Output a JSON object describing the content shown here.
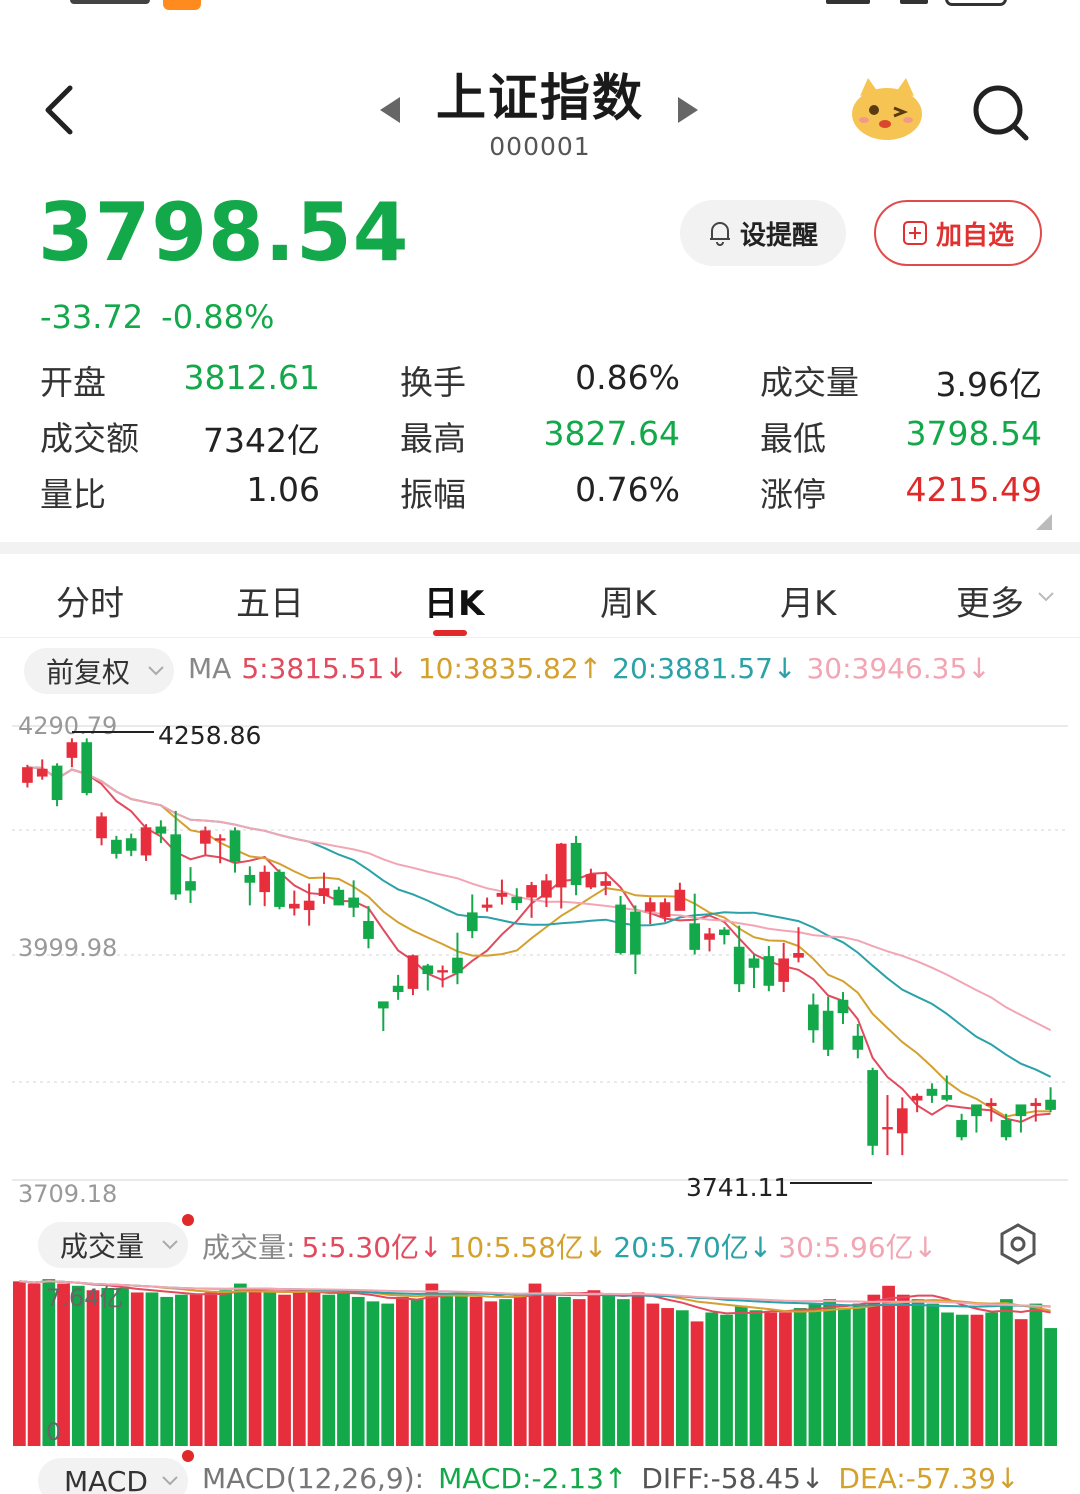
{
  "header": {
    "title": "上证指数",
    "code": "000001"
  },
  "quote": {
    "price": "3798.54",
    "change": "-33.72",
    "change_pct": "-0.88%"
  },
  "actions": {
    "alert_label": "设提醒",
    "watch_label": "加自选"
  },
  "stats": [
    [
      {
        "label": "开盘",
        "value": "3812.61",
        "tone": "green"
      },
      {
        "label": "换手",
        "value": "0.86%",
        "tone": "neutral"
      },
      {
        "label": "成交量",
        "value": "3.96亿",
        "tone": "neutral"
      }
    ],
    [
      {
        "label": "成交额",
        "value": "7342亿",
        "tone": "neutral"
      },
      {
        "label": "最高",
        "value": "3827.64",
        "tone": "green"
      },
      {
        "label": "最低",
        "value": "3798.54",
        "tone": "green"
      }
    ],
    [
      {
        "label": "量比",
        "value": "1.06",
        "tone": "neutral"
      },
      {
        "label": "振幅",
        "value": "0.76%",
        "tone": "neutral"
      },
      {
        "label": "涨停",
        "value": "4215.49",
        "tone": "red"
      }
    ]
  ],
  "tabs": [
    "分时",
    "五日",
    "日K",
    "周K",
    "月K",
    "更多"
  ],
  "active_tab": "日K",
  "kline": {
    "adjust_label": "前复权",
    "ma_prefix": "MA",
    "ma": [
      {
        "label": "5:3815.51",
        "color": "#e24a5e",
        "trend": "↓"
      },
      {
        "label": "10:3835.82",
        "color": "#d4a12f",
        "trend": "↑"
      },
      {
        "label": "20:3881.57",
        "color": "#2aa2a8",
        "trend": "↓"
      },
      {
        "label": "30:3946.35",
        "color": "#f2a6b4",
        "trend": "↓"
      }
    ],
    "axis_top": "4290.79",
    "axis_mid": "3999.98",
    "axis_bottom": "3709.18",
    "high_mark": "4258.86",
    "low_mark": "3741.11"
  },
  "volume": {
    "pill_label": "成交量",
    "prefix": "成交量:",
    "ma": [
      {
        "label": "5:5.30亿",
        "color": "#e24a5e",
        "trend": "↓"
      },
      {
        "label": "10:5.58亿",
        "color": "#d4a12f",
        "trend": "↓"
      },
      {
        "label": "20:5.70亿",
        "color": "#2aa2a8",
        "trend": "↓"
      },
      {
        "label": "30:5.96亿",
        "color": "#f2a6b4",
        "trend": "↓"
      }
    ],
    "axis_top": "7.64亿",
    "axis_bottom": "0"
  },
  "macd": {
    "pill_label": "MACD",
    "params": "MACD(12,26,9):",
    "macd": "MACD:-2.13↑",
    "diff": "DIFF:-58.45↓",
    "dea": "DEA:-57.39↓",
    "colors": {
      "macd": "#13a84a",
      "diff": "#555555",
      "dea": "#d4a12f"
    }
  },
  "colors": {
    "up": "#e62e3d",
    "down": "#13a84a",
    "accent": "#e02a2a"
  },
  "chart_data": [
    {
      "type": "candlestick",
      "title": "",
      "ylim": [
        3709.18,
        4290.79
      ],
      "y_ticks": [
        "4290.79",
        "3999.98",
        "3709.18"
      ],
      "annotations": [
        "4258.86",
        "3741.11"
      ],
      "candles": [
        [
          4218,
          4238,
          4212,
          4241
        ],
        [
          4226,
          4236,
          4222,
          4248
        ],
        [
          4240,
          4196,
          4188,
          4243
        ],
        [
          4250,
          4270,
          4238,
          4275
        ],
        [
          4270,
          4205,
          4202,
          4275
        ],
        [
          4147,
          4175,
          4138,
          4180
        ],
        [
          4145,
          4127,
          4121,
          4150
        ],
        [
          4147,
          4131,
          4124,
          4153
        ],
        [
          4125,
          4161,
          4118,
          4165
        ],
        [
          4162,
          4153,
          4141,
          4170
        ],
        [
          4152,
          4075,
          4068,
          4182
        ],
        [
          4092,
          4080,
          4064,
          4110
        ],
        [
          4140,
          4157,
          4126,
          4162
        ],
        [
          4144,
          4147,
          4115,
          4152
        ],
        [
          4157,
          4117,
          4103,
          4161
        ],
        [
          4100,
          4090,
          4061,
          4111
        ],
        [
          4078,
          4104,
          4060,
          4112
        ],
        [
          4104,
          4059,
          4056,
          4107
        ],
        [
          4057,
          4063,
          4048,
          4080
        ],
        [
          4055,
          4067,
          4035,
          4089
        ],
        [
          4073,
          4083,
          4063,
          4103
        ],
        [
          4081,
          4061,
          4061,
          4085
        ],
        [
          4071,
          4058,
          4046,
          4093
        ],
        [
          4041,
          4018,
          4006,
          4060
        ],
        [
          3938,
          3929,
          3900,
          3930
        ],
        [
          3958,
          3950,
          3940,
          3972
        ],
        [
          3954,
          3997,
          3946,
          3998
        ],
        [
          3984,
          3973,
          3952,
          3986
        ],
        [
          3975,
          3978,
          3956,
          3984
        ],
        [
          3994,
          3974,
          3960,
          4026
        ],
        [
          4052,
          4028,
          4019,
          4075
        ],
        [
          4058,
          4062,
          4053,
          4071
        ],
        [
          4072,
          4077,
          4062,
          4094
        ],
        [
          4072,
          4064,
          4055,
          4083
        ],
        [
          4071,
          4087,
          4045,
          4091
        ],
        [
          4071,
          4093,
          4059,
          4101
        ],
        [
          4084,
          4140,
          4057,
          4141
        ],
        [
          4141,
          4087,
          4074,
          4150
        ],
        [
          4084,
          4101,
          4082,
          4108
        ],
        [
          4086,
          4092,
          4074,
          4104
        ],
        [
          4062,
          4000,
          3998,
          4073
        ],
        [
          4053,
          3998,
          3973,
          4061
        ],
        [
          4053,
          4065,
          4037,
          4071
        ],
        [
          4046,
          4065,
          4040,
          4070
        ],
        [
          4054,
          4081,
          4069,
          4090
        ],
        [
          4038,
          4004,
          3998,
          4076
        ],
        [
          4017,
          4025,
          4002,
          4032
        ],
        [
          4030,
          4023,
          4011,
          4033
        ],
        [
          4008,
          3960,
          3950,
          4035
        ],
        [
          3993,
          3981,
          3955,
          3998
        ],
        [
          3996,
          3958,
          3951,
          4009
        ],
        [
          3963,
          3993,
          3950,
          4013
        ],
        [
          3994,
          4000,
          3988,
          4033
        ],
        [
          3934,
          3901,
          3885,
          3948
        ],
        [
          3926,
          3876,
          3868,
          3944
        ],
        [
          3940,
          3923,
          3909,
          3950
        ],
        [
          3894,
          3876,
          3865,
          3909
        ],
        [
          3850,
          3753,
          3741,
          3853
        ],
        [
          3774,
          3777,
          3741,
          3818
        ],
        [
          3769,
          3801,
          3741,
          3815
        ],
        [
          3811,
          3817,
          3796,
          3820
        ],
        [
          3826,
          3817,
          3808,
          3833
        ],
        [
          3818,
          3812,
          3810,
          3843
        ],
        [
          3786,
          3764,
          3760,
          3794
        ],
        [
          3806,
          3791,
          3770,
          3798
        ],
        [
          3804,
          3808,
          3784,
          3814
        ],
        [
          3786,
          3764,
          3760,
          3794
        ],
        [
          3806,
          3791,
          3770,
          3798
        ],
        [
          3804,
          3808,
          3784,
          3814
        ],
        [
          3812,
          3799,
          3796,
          3828
        ]
      ],
      "note": "candles as [open, close, low, high]"
    },
    {
      "type": "bar",
      "title": "",
      "ylim": [
        0,
        7.64
      ],
      "y_ticks": [
        "7.64亿",
        "0"
      ],
      "series": [
        {
          "values": [
            7.4,
            7.3,
            7.5,
            7.3,
            7.2,
            7.0,
            7.1,
            7.1,
            6.9,
            6.9,
            6.7,
            6.8,
            6.8,
            6.9,
            7.0,
            7.3,
            7.1,
            6.9,
            6.8,
            6.9,
            7.0,
            6.8,
            6.9,
            6.7,
            6.5,
            6.4,
            6.7,
            6.6,
            7.3,
            6.8,
            6.9,
            6.7,
            6.5,
            6.6,
            6.8,
            7.3,
            6.9,
            6.7,
            6.6,
            7.0,
            6.8,
            6.6,
            6.9,
            6.4,
            6.2,
            6.1,
            5.6,
            6.0,
            5.9,
            6.3,
            6.1,
            6.0,
            6.0,
            6.2,
            6.4,
            6.6,
            6.2,
            6.4,
            6.8,
            7.2,
            6.8,
            6.6,
            6.4,
            6.0,
            5.9,
            5.9,
            6.0,
            6.6,
            5.7,
            6.4,
            5.3
          ]
        }
      ]
    }
  ]
}
